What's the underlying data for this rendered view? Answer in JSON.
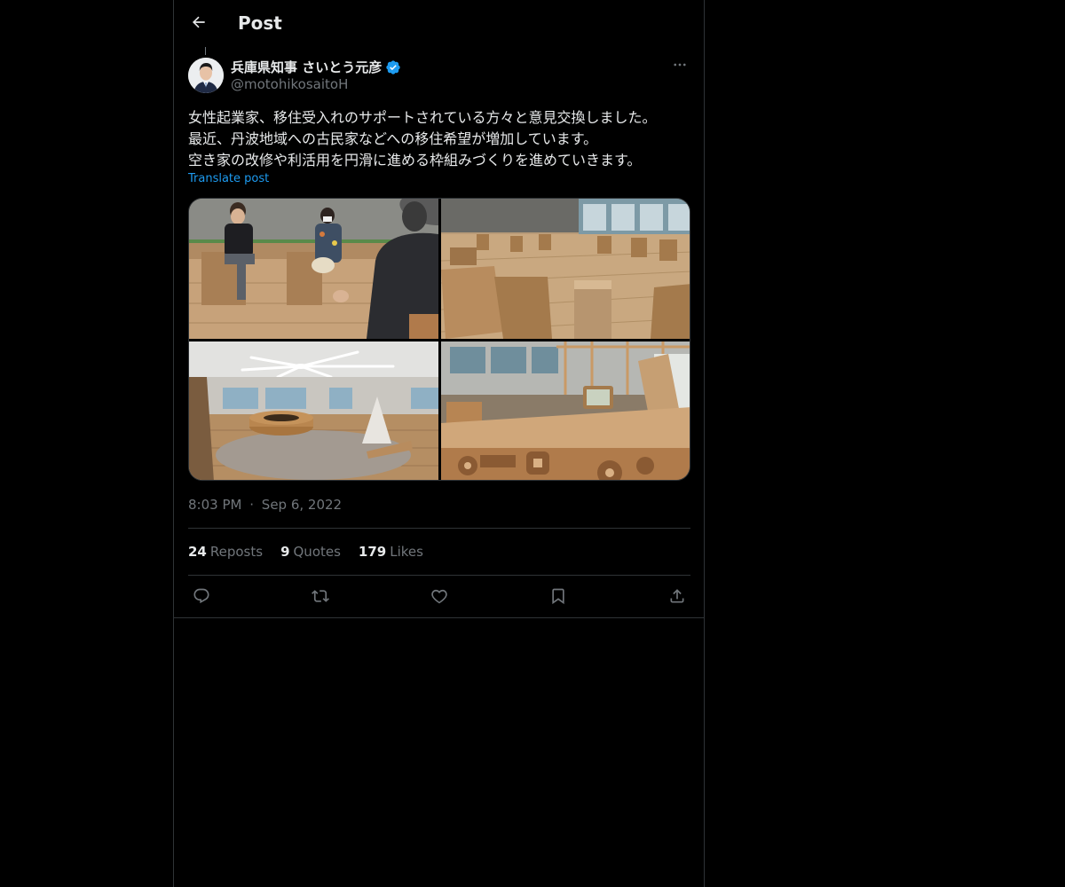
{
  "header": {
    "title": "Post"
  },
  "author": {
    "name": "兵庫県知事 さいとう元彦",
    "handle": "@motohikosaitoH",
    "verified": true
  },
  "post": {
    "lines": [
      "女性起業家、移住受入れのサポートされている方々と意見交換しました。",
      "最近、丹波地域への古民家などへの移住希望が増加しています。",
      "空き家の改修や利活用を円滑に進める枠組みづくりを進めていきます。"
    ],
    "translate_label": "Translate post",
    "time": "8:03 PM",
    "separator": "·",
    "date": "Sep 6, 2022"
  },
  "stats": {
    "reposts_count": "24",
    "reposts_label": "Reposts",
    "quotes_count": "9",
    "quotes_label": "Quotes",
    "likes_count": "179",
    "likes_label": "Likes"
  },
  "icons": {
    "back": "arrow-left-icon",
    "more": "more-horizontal-icon",
    "verified": "verified-badge-icon",
    "reply": "reply-icon",
    "repost": "repost-icon",
    "like": "heart-icon",
    "bookmark": "bookmark-icon",
    "share": "share-icon"
  },
  "colors": {
    "background": "#000000",
    "text": "#e7e9ea",
    "muted": "#71767b",
    "accent": "#1d9bf0",
    "border": "#2f3336"
  }
}
